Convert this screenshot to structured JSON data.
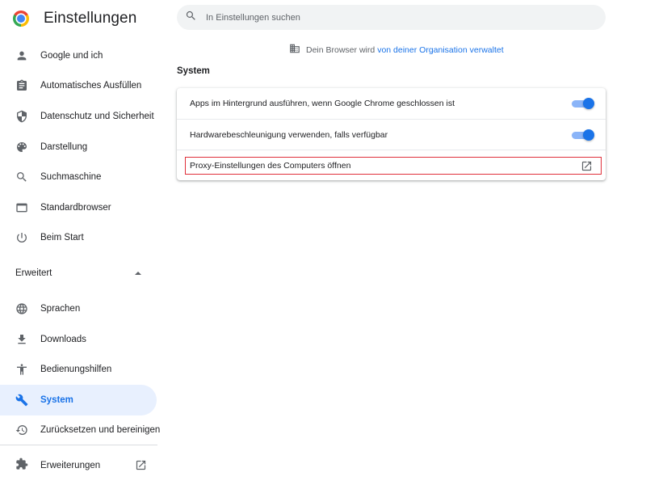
{
  "app": {
    "title": "Einstellungen"
  },
  "search": {
    "placeholder": "In Einstellungen suchen",
    "value": ""
  },
  "managed_notice": {
    "prefix": "Dein Browser wird",
    "link": "von deiner Organisation verwaltet"
  },
  "sidebar": {
    "items": [
      {
        "label": "Google und ich",
        "icon": "person-icon"
      },
      {
        "label": "Automatisches Ausfüllen",
        "icon": "clipboard-icon"
      },
      {
        "label": "Datenschutz und Sicherheit",
        "icon": "shield-icon"
      },
      {
        "label": "Darstellung",
        "icon": "palette-icon"
      },
      {
        "label": "Suchmaschine",
        "icon": "search-icon"
      },
      {
        "label": "Standardbrowser",
        "icon": "browser-window-icon"
      },
      {
        "label": "Beim Start",
        "icon": "power-icon"
      }
    ],
    "advanced_label": "Erweitert",
    "advanced_items": [
      {
        "label": "Sprachen",
        "icon": "globe-icon"
      },
      {
        "label": "Downloads",
        "icon": "download-icon"
      },
      {
        "label": "Bedienungshilfen",
        "icon": "accessibility-icon"
      },
      {
        "label": "System",
        "icon": "wrench-icon",
        "active": true
      },
      {
        "label": "Zurücksetzen und bereinigen",
        "icon": "restore-icon"
      }
    ],
    "extensions_label": "Erweiterungen"
  },
  "main": {
    "section_title": "System",
    "rows": [
      {
        "label": "Apps im Hintergrund ausführen, wenn Google Chrome geschlossen ist",
        "toggle": true
      },
      {
        "label": "Hardwarebeschleunigung verwenden, falls verfügbar",
        "toggle": true
      },
      {
        "label": "Proxy-Einstellungen des Computers öffnen",
        "external": true
      }
    ]
  },
  "colors": {
    "accent": "#1a73e8",
    "active_bg": "#e8f0fe",
    "highlight_border": "#e0303a"
  }
}
